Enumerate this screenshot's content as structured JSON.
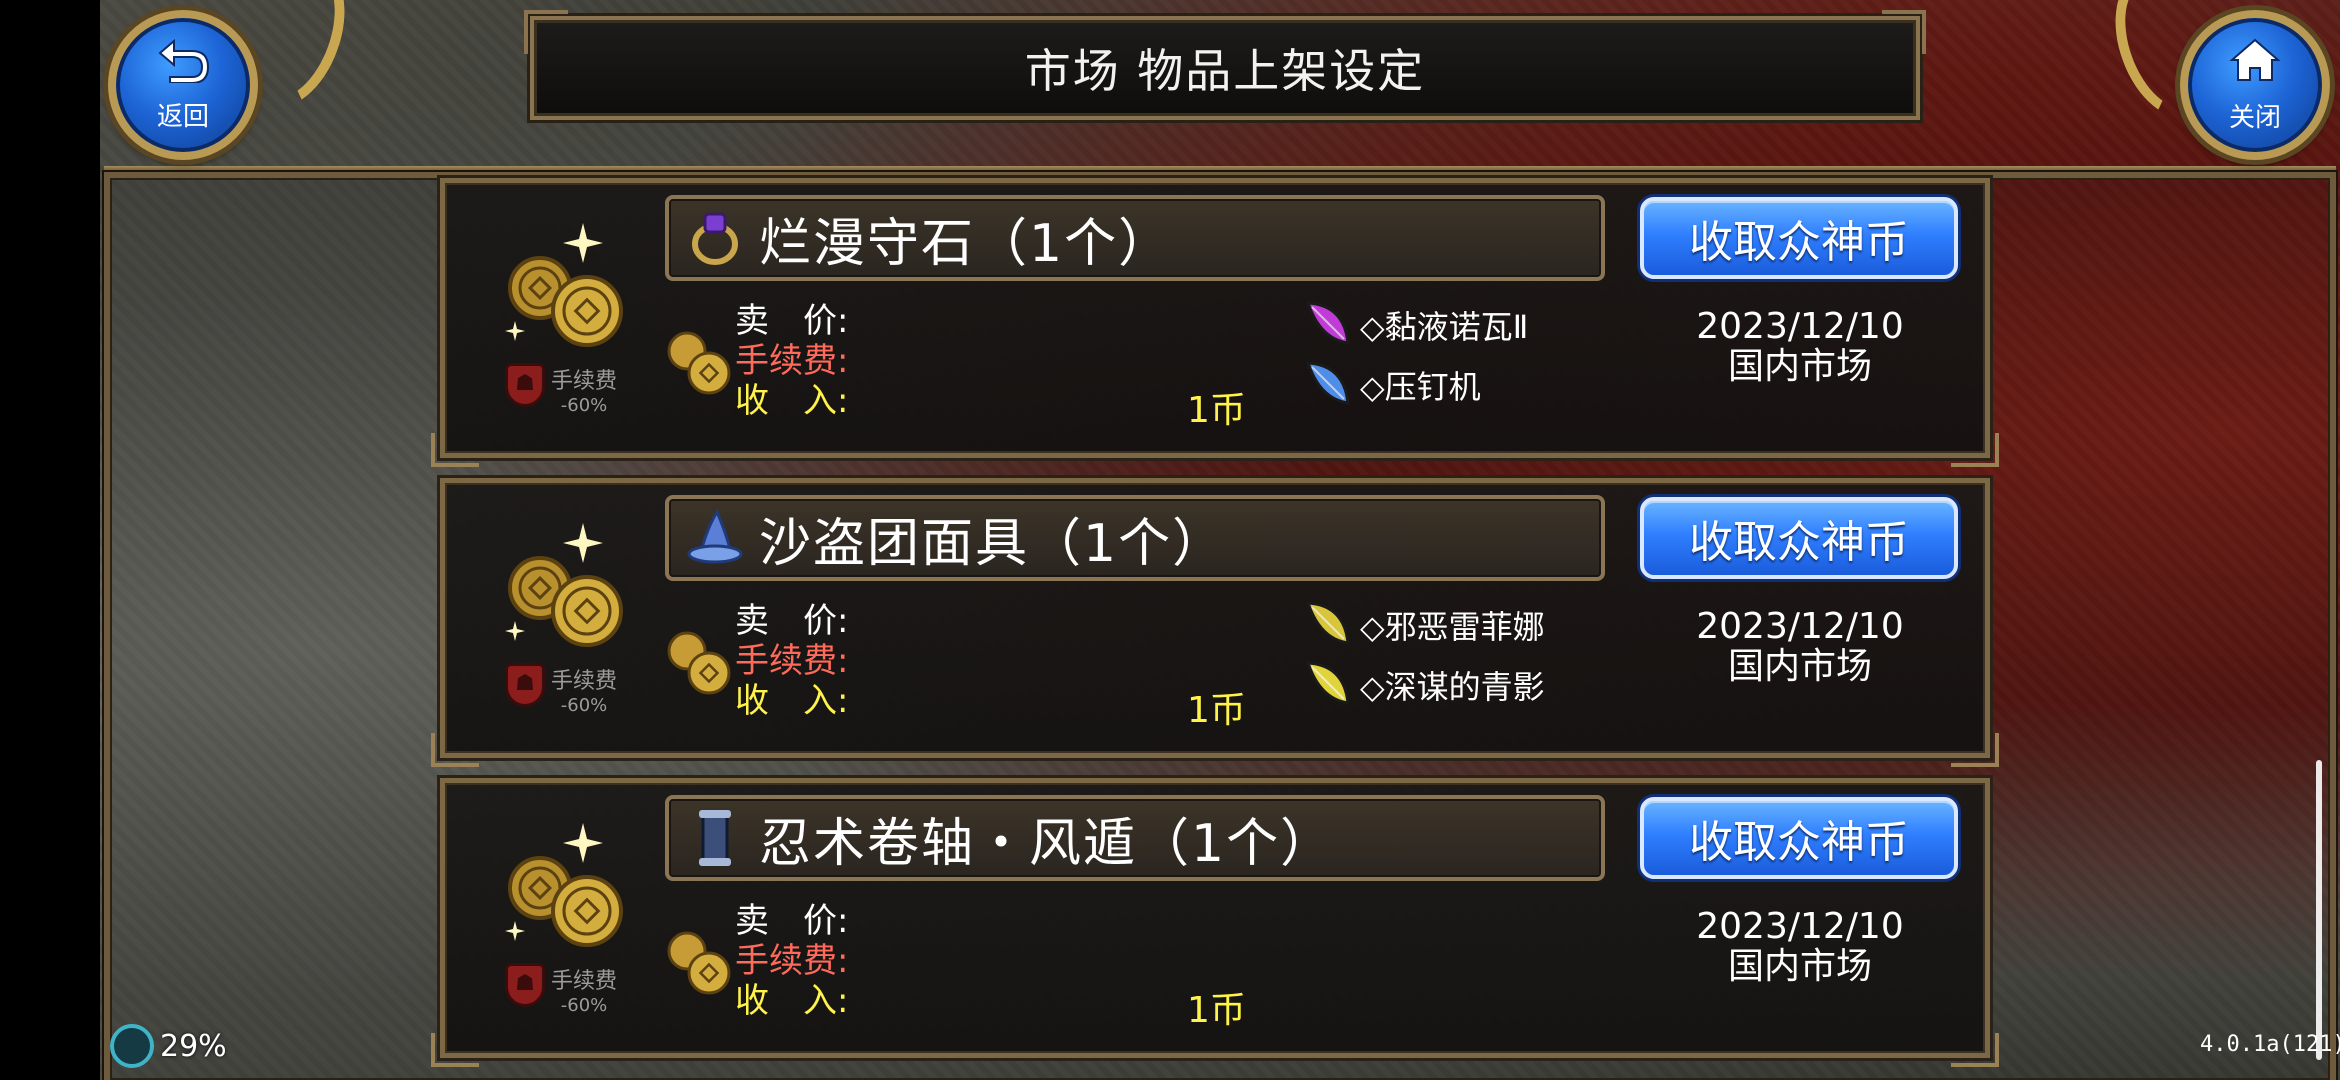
{
  "header": {
    "title": "市场 物品上架设定",
    "back_label": "返回",
    "close_label": "关闭"
  },
  "listings": [
    {
      "item_name": "烂漫守石（1个）",
      "item_icon": "ring-icon",
      "collect_label": "收取众神币",
      "price_label": "卖　价:",
      "fee_label": "手续费:",
      "income_label": "收　入:",
      "income_value": "1币",
      "fee_badge_label": "手续费",
      "fee_badge_pct": "-60%",
      "sellers": [
        {
          "name": "◇黏液诺瓦Ⅱ",
          "color": "#c03cd6"
        },
        {
          "name": "◇压钉机",
          "color": "#4f8ee8"
        }
      ],
      "date": "2023/12/10",
      "market": "国内市场"
    },
    {
      "item_name": "沙盗团面具（1个）",
      "item_icon": "wizard-hat-icon",
      "collect_label": "收取众神币",
      "price_label": "卖　价:",
      "fee_label": "手续费:",
      "income_label": "收　入:",
      "income_value": "1币",
      "fee_badge_label": "手续费",
      "fee_badge_pct": "-60%",
      "sellers": [
        {
          "name": "◇邪恶雷菲娜",
          "color": "#d9c53a"
        },
        {
          "name": "◇深谋的青影",
          "color": "#e0d43a"
        }
      ],
      "date": "2023/12/10",
      "market": "国内市场"
    },
    {
      "item_name": "忍术卷轴・风遁（1个）",
      "item_icon": "scroll-icon",
      "collect_label": "收取众神币",
      "price_label": "卖　价:",
      "fee_label": "手续费:",
      "income_label": "收　入:",
      "income_value": "1币",
      "fee_badge_label": "手续费",
      "fee_badge_pct": "-60%",
      "sellers": [],
      "date": "2023/12/10",
      "market": "国内市场"
    }
  ],
  "status": {
    "battery": "29%",
    "version": "4.0.1a(121)"
  }
}
